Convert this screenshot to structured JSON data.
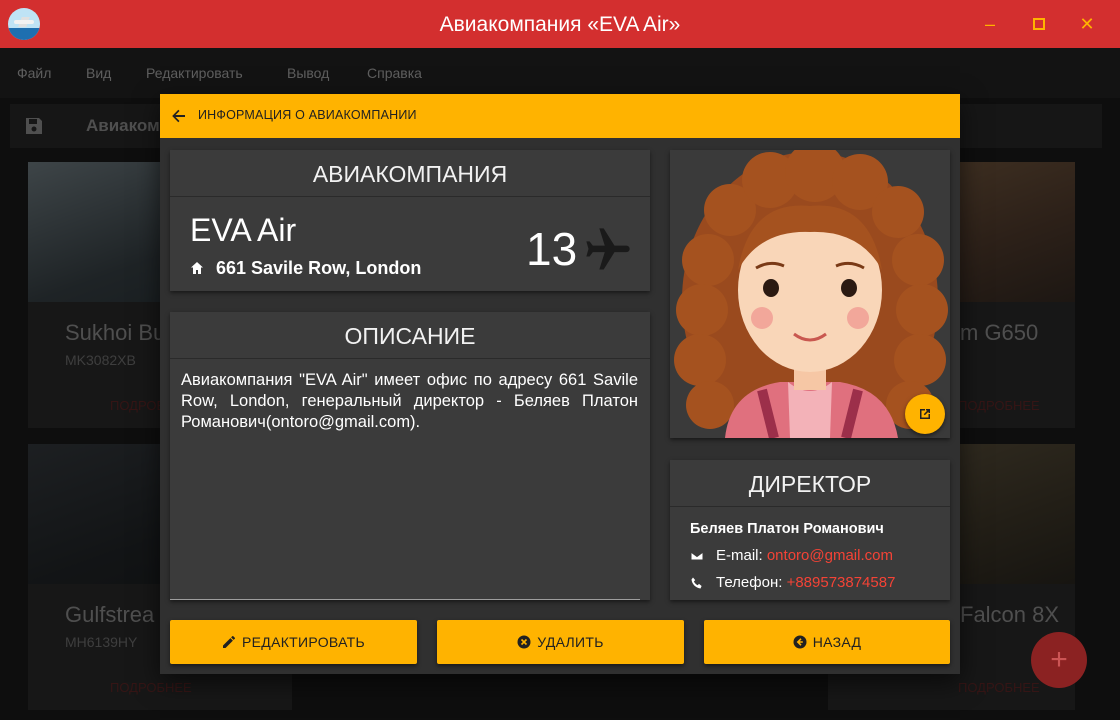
{
  "window": {
    "title": "Авиакомпания «EVA Air»"
  },
  "menu": [
    "Файл",
    "Вид",
    "Редактировать",
    "Вывод",
    "Справка"
  ],
  "background": {
    "toolbar_title": "Авиаком",
    "cards": [
      {
        "name": "Sukhoi Bu",
        "reg": "MK3082XB",
        "link": "ПОДРОБНЕЕ"
      },
      {
        "name": "m G650",
        "reg": "",
        "link": "ПОДРОБНЕЕ"
      },
      {
        "name": "Gulfstrea",
        "reg": "MH6139HY",
        "link": "ПОДРОБНЕЕ"
      },
      {
        "name": "Falcon 8X",
        "reg": "",
        "link": "ПОДРОБНЕЕ"
      }
    ]
  },
  "dialog": {
    "header": "ИНФОРМАЦИЯ О АВИАКОМПАНИИ",
    "airline": {
      "section_title": "АВИАКОМПАНИЯ",
      "name": "EVA Air",
      "address": "661 Savile Row, London",
      "fleet_count": "13"
    },
    "description": {
      "section_title": "ОПИСАНИЕ",
      "text": "Авиакомпания \"EVA Air\" имеет офис по адресу 661 Savile Row, London, генеральный директор - Беляев Платон Романович(ontoro@gmail.com)."
    },
    "director": {
      "section_title": "ДИРЕКТОР",
      "name": "Беляев Платон Романович",
      "email_label": "E-mail: ",
      "email": "ontoro@gmail.com",
      "phone_label": "Телефон: ",
      "phone": "+889573874587"
    },
    "buttons": {
      "edit": "РЕДАКТИРОВАТЬ",
      "delete": "УДАЛИТЬ",
      "back": "НАЗАД"
    }
  },
  "colors": {
    "accent": "#ffb300",
    "titlebar": "#d32f2f",
    "link": "#f44336"
  }
}
